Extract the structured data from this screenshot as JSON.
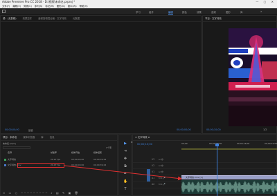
{
  "titlebar": {
    "title": "Adobe Premiere Pro CC 2018 - D:\\视频\\未命名.prproj *",
    "controls": "— ▢ ✕"
  },
  "menubar": {
    "items": [
      "文件(F)",
      "编辑(E)",
      "剪辑(C)",
      "序列(S)",
      "标记(M)",
      "图形(G)",
      "窗口(W)",
      "帮助(H)"
    ]
  },
  "workspaces": {
    "items": [
      "学习",
      "组件",
      "编辑",
      "颜色",
      "效果",
      "音频",
      "图形",
      "库"
    ],
    "active_index": 2,
    "more": "»"
  },
  "source_panel": {
    "tabs": [
      "源：(无剪辑)",
      "效果控件",
      "音频剪辑混合器：文字特效",
      "元数据"
    ],
    "timecode_left": "00;00;00;00",
    "fit": "适合",
    "timecode_right": "00;00;00;00",
    "controls": "▾ { } |◀ ◀| ▶ |▶ ▶| ⊞ ⊟ ◉",
    "add": "+"
  },
  "program_panel": {
    "tabs": [
      "节目：文字特效"
    ],
    "timecode_left": "00;00;10;00",
    "fit": "适合",
    "timecode_right": "1/2",
    "controls": "|◀ ◀| ▶ |▶ ▶|"
  },
  "project_panel": {
    "tabs": [
      "项目：未命名",
      "媒体浏览器",
      "库",
      "信息"
    ],
    "path": "未命名.prproj",
    "count": "2个项",
    "headers": {
      "name": "名称",
      "frame_rate": "帧速率",
      "media_start": "媒体开始",
      "media_end": "媒体结束"
    },
    "rows": [
      {
        "name": "文字特效",
        "frame_rate": "29.97 fps",
        "media_start": "00;00;00;00",
        "media_end": "00;00;39;24",
        "color": "#3d9f5a"
      },
      {
        "name": "文字特效.mov",
        "frame_rate": "29.97 fps",
        "media_start": "00;00;00;00",
        "media_end": "00;00;39;24",
        "color": "#4a78c8"
      }
    ],
    "footer": "≡ ▭ ○ ───────── ⌕ ▤ ✎ ▣ 🗑"
  },
  "tools": {
    "items": [
      "▶",
      "⇥",
      "✥",
      "⧉",
      "✒",
      "✋",
      "T"
    ],
    "active_index": 0
  },
  "timeline_panel": {
    "tabs": [
      "× 文字特效 ≡"
    ],
    "timecode": "00;00;10;00",
    "ruler": [
      "00;00",
      "00;00;08;00",
      "00;00;16;00",
      "00;00;24;00"
    ],
    "tracks": [
      {
        "label": "V3",
        "type": "video"
      },
      {
        "label": "V2",
        "type": "video"
      },
      {
        "label": "V1",
        "type": "video",
        "targeted": true
      },
      {
        "label": "A1",
        "type": "audio",
        "targeted": true
      },
      {
        "label": "A2",
        "type": "audio"
      }
    ],
    "clip_name": "文字特效.mov [V]",
    "accent_color": "#3d7fd9"
  }
}
